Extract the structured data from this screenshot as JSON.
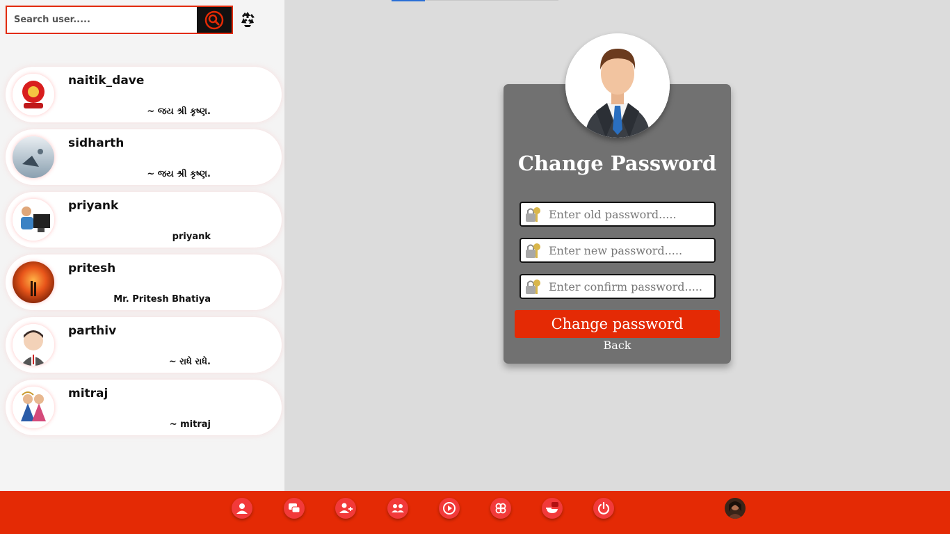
{
  "search": {
    "placeholder": "Search user....."
  },
  "users": [
    {
      "name": "naitik_dave",
      "status": "~ જય શ્રી કૃષ્ણ."
    },
    {
      "name": "sidharth",
      "status": "~ જય શ્રી કૃષ્ણ."
    },
    {
      "name": "priyank",
      "status": "priyank"
    },
    {
      "name": "pritesh",
      "status": "Mr. Pritesh Bhatiya"
    },
    {
      "name": "parthiv",
      "status": "~ રાધે રાધે."
    },
    {
      "name": "mitraj",
      "status": "~ mitraj"
    }
  ],
  "form": {
    "title": "Change Password",
    "old_placeholder": "Enter old password.....",
    "new_placeholder": "Enter new password.....",
    "confirm_placeholder": "Enter confirm password.....",
    "submit_label": "Change password",
    "back_label": "Back"
  },
  "nav": [
    {
      "icon": "profile-icon"
    },
    {
      "icon": "chat-icon"
    },
    {
      "icon": "add-user-icon"
    },
    {
      "icon": "group-icon"
    },
    {
      "icon": "video-play-icon"
    },
    {
      "icon": "discover-icon"
    },
    {
      "icon": "new-chat-icon"
    },
    {
      "icon": "power-icon"
    }
  ],
  "colors": {
    "accent": "#e42a05",
    "card": "#717171",
    "sidebar": "#f4f4f4",
    "main": "#dcdcdc"
  }
}
